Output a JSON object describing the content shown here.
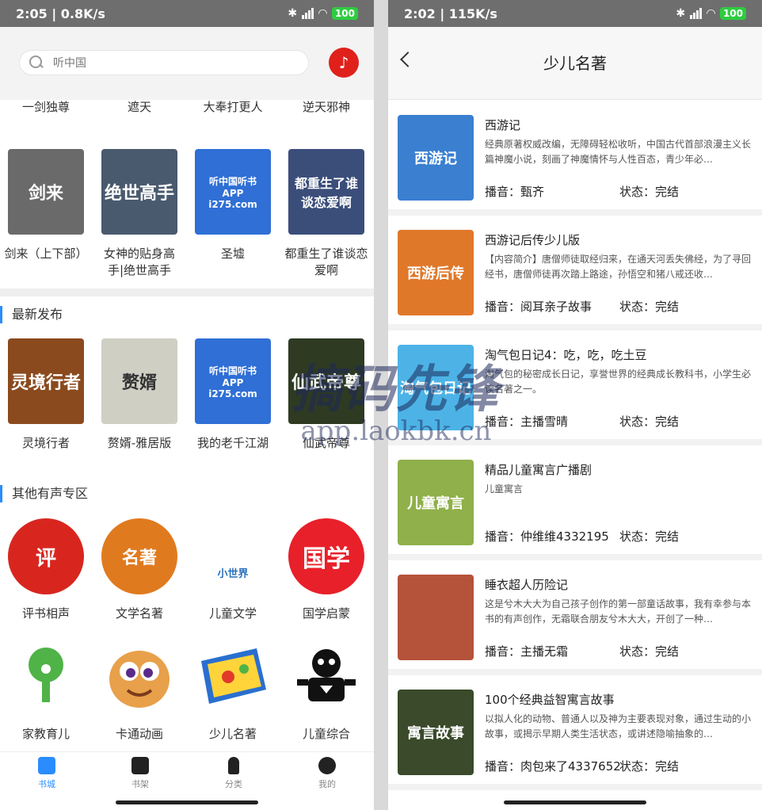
{
  "left": {
    "status": {
      "time": "2:05",
      "speed": "0.8K/s",
      "battery": "100"
    },
    "search": {
      "placeholder": "听中国"
    },
    "cut_row": [
      "一剑独尊",
      "遮天",
      "大奉打更人",
      "逆天邪神"
    ],
    "row1": [
      {
        "title": "剑来（上下部）",
        "cover_text": "剑来",
        "color": "#6a6a6a"
      },
      {
        "title": "女神的贴身高手|绝世高手",
        "cover_text": "绝世高手",
        "color": "#4a5a6e"
      },
      {
        "title": "圣墟",
        "cover_text": "听中国听书 APP i275.com",
        "color": "#2f6fd6"
      },
      {
        "title": "都重生了谁谈恋爱啊",
        "cover_text": "都重生了谁谈恋爱啊",
        "color": "#3b4e7a"
      }
    ],
    "section_latest": "最新发布",
    "row2": [
      {
        "title": "灵境行者",
        "cover_text": "灵境行者",
        "color": "#8a4a1e"
      },
      {
        "title": "赘婿-雅居版",
        "cover_text": "赘婿",
        "color": "#cfcfc4"
      },
      {
        "title": "我的老千江湖",
        "cover_text": "听中国听书 APP i275.com",
        "color": "#2f6fd6"
      },
      {
        "title": "仙武帝尊",
        "cover_text": "仙武帝尊",
        "color": "#2e3a22"
      }
    ],
    "section_other": "其他有声专区",
    "row3": [
      {
        "title": "评书相声",
        "icon": "评",
        "color": "#d8261f"
      },
      {
        "title": "文学名著",
        "icon": "名著",
        "color": "#e07a1f"
      },
      {
        "title": "儿童文学",
        "icon": "小世界",
        "color": "#ffffff"
      },
      {
        "title": "国学启蒙",
        "icon": "国学",
        "color": "#e8202a"
      }
    ],
    "row4": [
      {
        "title": "家教育儿",
        "icon": "tree-icon",
        "color": "#ffffff"
      },
      {
        "title": "卡通动画",
        "icon": "monster-icon",
        "color": "#ffffff"
      },
      {
        "title": "少儿名著",
        "icon": "boardgame-icon",
        "color": "#ffffff"
      },
      {
        "title": "儿童综合",
        "icon": "robot-icon",
        "color": "#ffffff"
      }
    ],
    "tabs": [
      {
        "label": "书城",
        "active": true
      },
      {
        "label": "书架"
      },
      {
        "label": "分类"
      },
      {
        "label": "我的"
      }
    ]
  },
  "right": {
    "status": {
      "time": "2:02",
      "speed": "115K/s",
      "battery": "100"
    },
    "title": "少儿名著",
    "items": [
      {
        "name": "西游记",
        "desc": "经典原著权威改编，无障碍轻松收听，中国古代首部浪漫主义长篇神魔小说，刻画了神魔情怀与人性百态，青少年必…",
        "anchor": "播音：甄齐",
        "state": "状态：完结",
        "cover_text": "西游记",
        "color": "#3a7fd0"
      },
      {
        "name": "西游记后传少儿版",
        "desc": "【内容简介】唐僧师徒取经归来，在通天河丢失佛经，为了寻回经书，唐僧师徒再次踏上路途，孙悟空和猪八戒还收…",
        "anchor": "播音：阅耳亲子故事",
        "state": "状态：完结",
        "cover_text": "西游后传",
        "color": "#e0782a"
      },
      {
        "name": "淘气包日记4：吃，吃，吃土豆",
        "desc": "淘气包的秘密成长日记，享誉世界的经典成长教科书，小学生必读名著之一。",
        "anchor": "播音：主播雪晴",
        "state": "状态：完结",
        "cover_text": "淘气包日记",
        "color": "#4db3e6"
      },
      {
        "name": "精品儿童寓言广播剧",
        "desc": "儿童寓言",
        "anchor": "播音：仲维维4332195",
        "state": "状态：完结",
        "cover_text": "儿童寓言",
        "color": "#8fb04a"
      },
      {
        "name": "睡衣超人历险记",
        "desc": "这是兮木大大为自己孩子创作的第一部童话故事，我有幸参与本书的有声创作，无霜联合朋友兮木大大，开创了一种…",
        "anchor": "播音：主播无霜",
        "state": "状态：完结",
        "cover_text": "",
        "color": "#b5523a"
      },
      {
        "name": "100个经典益智寓言故事",
        "desc": "以拟人化的动物、普通人以及神为主要表现对象，通过生动的小故事，或揭示早期人类生活状态，或讲述隐喻抽象的…",
        "anchor": "播音：肉包来了4337652",
        "state": "状态：完结",
        "cover_text": "寓言故事",
        "color": "#3a4a2a"
      }
    ]
  },
  "watermark": {
    "cn": "搞码先锋",
    "url": "app.laokbk.cn"
  }
}
